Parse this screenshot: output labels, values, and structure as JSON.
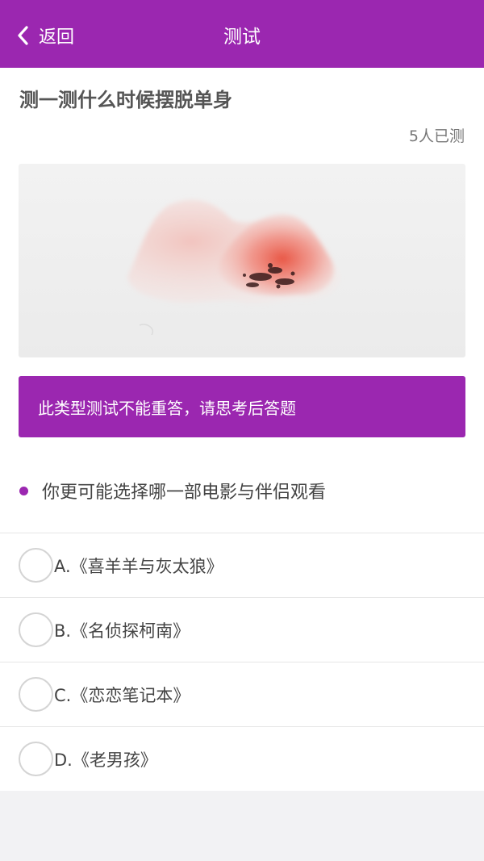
{
  "navbar": {
    "back_label": "返回",
    "title": "测试",
    "color": "#9b27b0"
  },
  "quiz": {
    "title": "测一测什么时候摆脱单身",
    "tested_count": "5人已测",
    "notice": "此类型测试不能重答，请思考后答题",
    "question": "你更可能选择哪一部电影与伴侣观看",
    "options": [
      {
        "label": "A.《喜羊羊与灰太狼》"
      },
      {
        "label": "B.《名侦探柯南》"
      },
      {
        "label": "C.《恋恋笔记本》"
      },
      {
        "label": "D.《老男孩》"
      }
    ]
  },
  "icons": {
    "back": "chevron-left-icon",
    "option_radio": "radio-icon"
  }
}
